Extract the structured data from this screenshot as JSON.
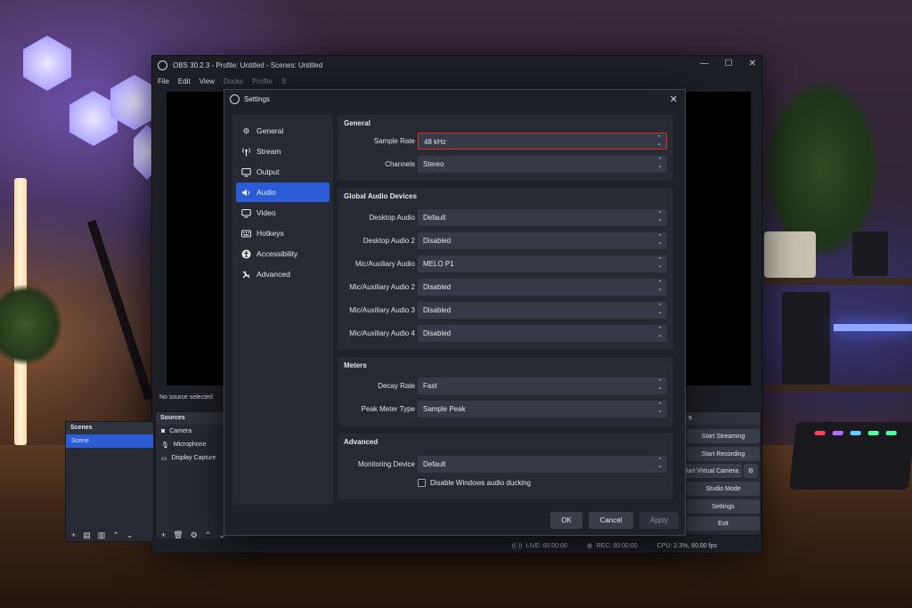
{
  "main_window": {
    "title": "OBS 30.2.3 - Profile: Untitled - Scenes: Untitled",
    "window_controls": [
      "—",
      "☐",
      "✕"
    ],
    "menu": [
      "File",
      "Edit",
      "View",
      "Docks",
      "Profile",
      "S"
    ],
    "no_source_text": "No source selected",
    "scenes": {
      "title": "Scenes",
      "items": [
        "Scene"
      ]
    },
    "sources": {
      "title": "Sources",
      "items": [
        {
          "label": "Camera",
          "icon": "camera-icon"
        },
        {
          "label": "Microphone",
          "icon": "microphone-icon"
        },
        {
          "label": "Display Capture",
          "icon": "monitor-icon"
        }
      ]
    },
    "controls": {
      "header": "s",
      "start_streaming": "Start Streaming",
      "start_recording": "Start Recording",
      "start_virtual_camera": "tart Virtual Camera",
      "studio_mode": "Studio Mode",
      "settings": "Settings",
      "exit": "Exit"
    },
    "status": {
      "live": "LIVE: 00:00:00",
      "rec": "REC: 00:00:00",
      "cpu": "CPU: 2.3%, 60.00 fps"
    }
  },
  "settings_dialog": {
    "title": "Settings",
    "nav": [
      {
        "label": "General",
        "icon": "gear-icon",
        "active": false
      },
      {
        "label": "Stream",
        "icon": "antenna-icon",
        "active": false
      },
      {
        "label": "Output",
        "icon": "output-monitor-icon",
        "active": false
      },
      {
        "label": "Audio",
        "icon": "speaker-icon",
        "active": true
      },
      {
        "label": "Video",
        "icon": "monitor-icon",
        "active": false
      },
      {
        "label": "Hotkeys",
        "icon": "keyboard-icon",
        "active": false
      },
      {
        "label": "Accessibility",
        "icon": "accessibility-icon",
        "active": false
      },
      {
        "label": "Advanced",
        "icon": "wrench-icon",
        "active": false
      }
    ],
    "general": {
      "title": "General",
      "sample_rate": {
        "label": "Sample Rate",
        "value": "48 kHz"
      },
      "channels": {
        "label": "Channels",
        "value": "Stereo"
      }
    },
    "global_audio": {
      "title": "Global Audio Devices",
      "rows": [
        {
          "label": "Desktop Audio",
          "value": "Default"
        },
        {
          "label": "Desktop Audio 2",
          "value": "Disabled"
        },
        {
          "label": "Mic/Auxiliary Audio",
          "value": "MELO P1"
        },
        {
          "label": "Mic/Auxiliary Audio 2",
          "value": "Disabled"
        },
        {
          "label": "Mic/Auxiliary Audio 3",
          "value": "Disabled"
        },
        {
          "label": "Mic/Auxiliary Audio 4",
          "value": "Disabled"
        }
      ]
    },
    "meters": {
      "title": "Meters",
      "decay_rate": {
        "label": "Decay Rate",
        "value": "Fast"
      },
      "peak_meter_type": {
        "label": "Peak Meter Type",
        "value": "Sample Peak"
      }
    },
    "advanced": {
      "title": "Advanced",
      "monitoring_device": {
        "label": "Monitoring Device",
        "value": "Default"
      },
      "ducking_checkbox": {
        "label": "Disable Windows audio ducking",
        "checked": false
      }
    },
    "buttons": {
      "ok": "OK",
      "cancel": "Cancel",
      "apply": "Apply"
    }
  },
  "colors": {
    "accent": "#2c5bd6",
    "highlight_border": "#e02b2b",
    "dialog_bg": "#1f2128",
    "panel_bg": "#272a33",
    "field_bg": "#363a46"
  }
}
